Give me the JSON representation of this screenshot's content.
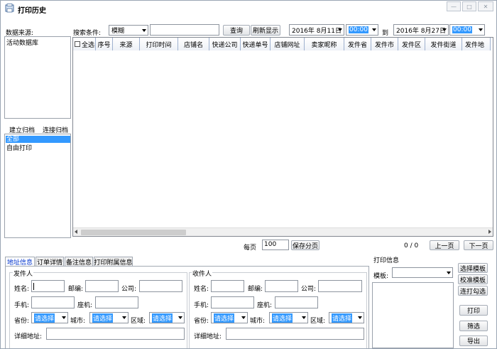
{
  "window": {
    "title": "打印历史"
  },
  "left": {
    "datasource_label": "数据来源:",
    "datasource_items": [
      "活动数据库"
    ],
    "archive_tabs": [
      "建立归档",
      "连接归档"
    ],
    "archive_items": [
      "全部",
      "自由打印"
    ]
  },
  "search": {
    "condition_label": "搜索条件:",
    "mode_value": "模糊",
    "query_value": "",
    "query_button": "查询",
    "refresh_button": "刷新显示",
    "start_date": "2016年 8月11日",
    "start_time": "00:00",
    "to_label": "到",
    "end_date": "2016年 8月27日",
    "end_time": "00:00"
  },
  "table": {
    "columns": [
      "全选",
      "序号",
      "来源",
      "打印时间",
      "店铺名",
      "快递公司",
      "快递单号",
      "店铺网址",
      "卖家昵称",
      "发件省",
      "发件市",
      "发件区",
      "发件街道",
      "发件地"
    ]
  },
  "pagination": {
    "per_page_label": "每页",
    "per_page_value": "100",
    "save_button": "保存分页",
    "page_info": "0 / 0",
    "prev_button": "上一页",
    "next_button": "下一页"
  },
  "detail_tabs": [
    "地址信息",
    "订单详情",
    "备注信息",
    "打印附属信息"
  ],
  "sender": {
    "title": "发件人",
    "name_label": "姓名:",
    "zip_label": "邮编:",
    "company_label": "公司:",
    "mobile_label": "手机:",
    "phone_label": "座机:",
    "province_label": "省份:",
    "province_value": "请选择",
    "city_label": "城市:",
    "city_value": "请选择",
    "district_label": "区域:",
    "district_value": "请选择",
    "address_label": "详细地址:"
  },
  "receiver": {
    "title": "收件人",
    "name_label": "姓名:",
    "zip_label": "邮编:",
    "company_label": "公司:",
    "mobile_label": "手机:",
    "phone_label": "座机:",
    "province_label": "省份:",
    "province_value": "请选择",
    "city_label": "城市:",
    "city_value": "请选择",
    "district_label": "区域:",
    "district_value": "请选择",
    "address_label": "详细地址:"
  },
  "print": {
    "title": "打印信息",
    "template_label": "模板:",
    "template_value": "",
    "select_template_button": "选择模板",
    "calibrate_template_button": "校准模板",
    "print_selected_button": "连打勾选",
    "print_button": "打印",
    "filter_button": "筛选",
    "export_button": "导出"
  },
  "colors": {
    "selection": "#3399ff",
    "border": "#828790",
    "tab_active_text": "#0033cc"
  }
}
